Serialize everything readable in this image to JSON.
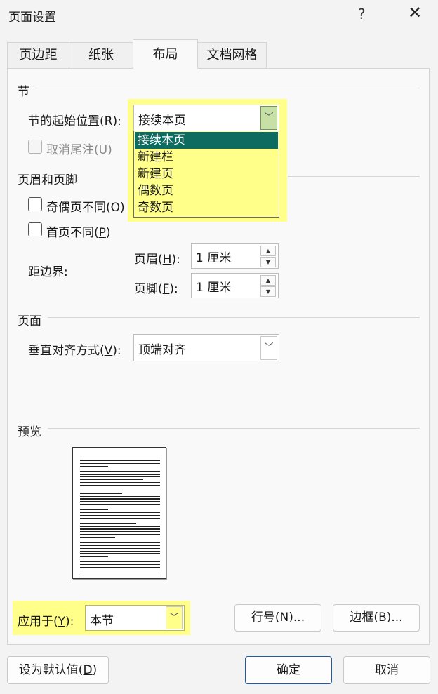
{
  "window": {
    "title": "页面设置",
    "help": "?",
    "close": "✕"
  },
  "tabs": [
    "页边距",
    "纸张",
    "布局",
    "文档网格"
  ],
  "section": {
    "group_label": "节",
    "start_label": "节的起始位置(",
    "start_key": "R",
    "start_label_end": "):",
    "start_value": "接续本页",
    "start_options": [
      "接续本页",
      "新建栏",
      "新建页",
      "偶数页",
      "奇数页"
    ],
    "suppress_endnotes_label": "取消尾注(U)"
  },
  "headers_footers": {
    "group_label": "页眉和页脚",
    "odd_even_label": "奇偶页不同(O)",
    "first_page_prefix": "首页不同(",
    "first_page_key": "P",
    "first_page_suffix": ")",
    "from_edge_label": "距边界:",
    "header_prefix": "页眉(",
    "header_key": "H",
    "header_suffix": "):",
    "header_value": "1 厘米",
    "footer_prefix": "页脚(",
    "footer_key": "F",
    "footer_suffix": "):",
    "footer_value": "1 厘米"
  },
  "page": {
    "group_label": "页面",
    "valign_prefix": "垂直对齐方式(",
    "valign_key": "V",
    "valign_suffix": "):",
    "valign_value": "顶端对齐"
  },
  "preview": {
    "group_label": "预览"
  },
  "apply": {
    "label_prefix": "应用于(",
    "label_key": "Y",
    "label_suffix": "):",
    "value": "本节",
    "line_numbers_prefix": "行号(",
    "line_numbers_key": "N",
    "line_numbers_suffix": ")...",
    "borders_prefix": "边框(",
    "borders_key": "B",
    "borders_suffix": ")..."
  },
  "footer": {
    "default_prefix": "设为默认值(",
    "default_key": "D",
    "default_suffix": ")",
    "ok": "确定",
    "cancel": "取消"
  },
  "colors": {
    "highlight": "#ffff8a",
    "selected_option": "#0d6b60",
    "dropdown_button_active": "#c6e0a6"
  }
}
